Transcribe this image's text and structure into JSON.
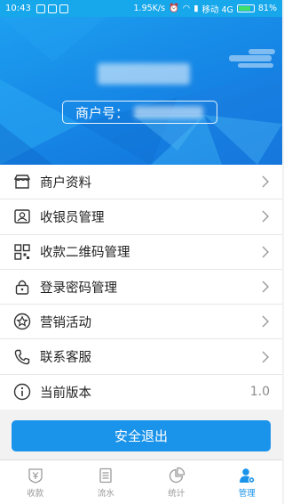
{
  "status_bar": {
    "time": "10:43",
    "speed": "1.95K/s",
    "carrier": "移动 4G",
    "battery": "81%"
  },
  "header": {
    "merchant_label": "商户号："
  },
  "menu": {
    "items": [
      {
        "label": "商户资料",
        "icon": "store-icon"
      },
      {
        "label": "收银员管理",
        "icon": "cashier-card-icon"
      },
      {
        "label": "收款二维码管理",
        "icon": "qr-code-icon"
      },
      {
        "label": "登录密码管理",
        "icon": "lock-icon"
      },
      {
        "label": "营销活动",
        "icon": "star-icon"
      },
      {
        "label": "联系客服",
        "icon": "phone-icon"
      },
      {
        "label": "当前版本",
        "icon": "info-icon",
        "value": "1.0"
      }
    ]
  },
  "logout_label": "安全退出",
  "bottom_nav": {
    "items": [
      {
        "label": "收款",
        "icon": "yuan-shield-icon",
        "active": false
      },
      {
        "label": "流水",
        "icon": "ledger-icon",
        "active": false
      },
      {
        "label": "统计",
        "icon": "pie-chart-icon",
        "active": false
      },
      {
        "label": "管理",
        "icon": "user-manage-icon",
        "active": true
      }
    ]
  },
  "colors": {
    "primary": "#1a93ea",
    "header_top": "#1d9ff0",
    "status_bar": "#17a7eb",
    "text": "#222222",
    "muted": "#9a9a9a"
  }
}
